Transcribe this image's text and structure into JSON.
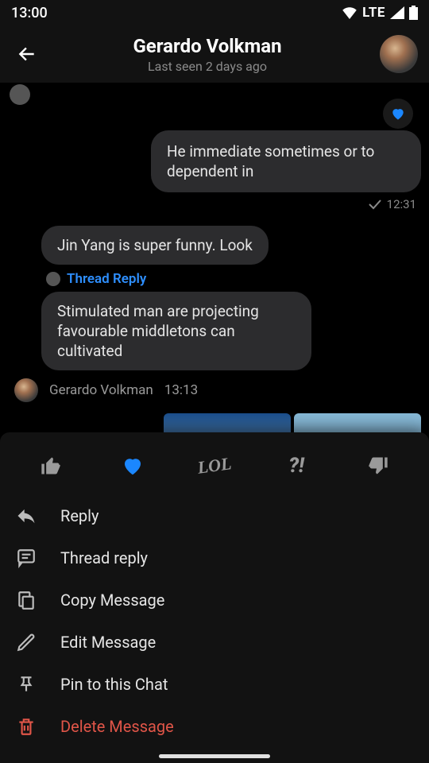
{
  "statusbar": {
    "time": "13:00",
    "network": "LTE"
  },
  "header": {
    "title": "Gerardo Volkman",
    "subtitle": "Last seen 2 days ago"
  },
  "reaction_heart": "♥",
  "messages": {
    "out1": {
      "text": "He immediate sometimes or to dependent in",
      "time": "12:31"
    },
    "in1": {
      "text": "Jin Yang is super funny. Look"
    },
    "thread_label": "Thread Reply",
    "in2": {
      "text": "Stimulated man are projecting favourable middletons can cultivated"
    },
    "in_meta": {
      "name": "Gerardo Volkman",
      "time": "13:13"
    }
  },
  "reactions": {
    "lol": "LOL",
    "question": "?!"
  },
  "menu": {
    "reply": "Reply",
    "thread_reply": "Thread reply",
    "copy": "Copy Message",
    "edit": "Edit Message",
    "pin": "Pin to this Chat",
    "delete": "Delete Message"
  },
  "colors": {
    "accent": "#1b87ff",
    "danger": "#e05548"
  }
}
